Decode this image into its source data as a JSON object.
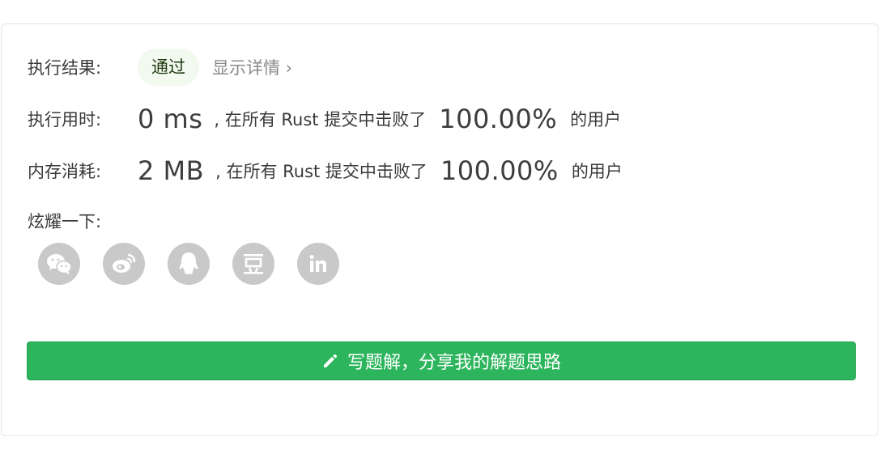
{
  "result": {
    "label": "执行结果:",
    "status": "通过",
    "detail_link": "显示详情 ›"
  },
  "runtime": {
    "label": "执行用时:",
    "value": "0 ms",
    "beat_prefix": ", 在所有 Rust 提交中击败了",
    "percent": "100.00%",
    "suffix": "的用户"
  },
  "memory": {
    "label": "内存消耗:",
    "value": "2 MB",
    "beat_prefix": ", 在所有 Rust 提交中击败了",
    "percent": "100.00%",
    "suffix": "的用户"
  },
  "share": {
    "label": "炫耀一下:",
    "icons": [
      "wechat-icon",
      "weibo-icon",
      "qq-icon",
      "douban-icon",
      "linkedin-icon"
    ]
  },
  "cta": {
    "label": "写题解，分享我的解题思路",
    "icon": "pencil-icon",
    "color": "#2db55d"
  }
}
